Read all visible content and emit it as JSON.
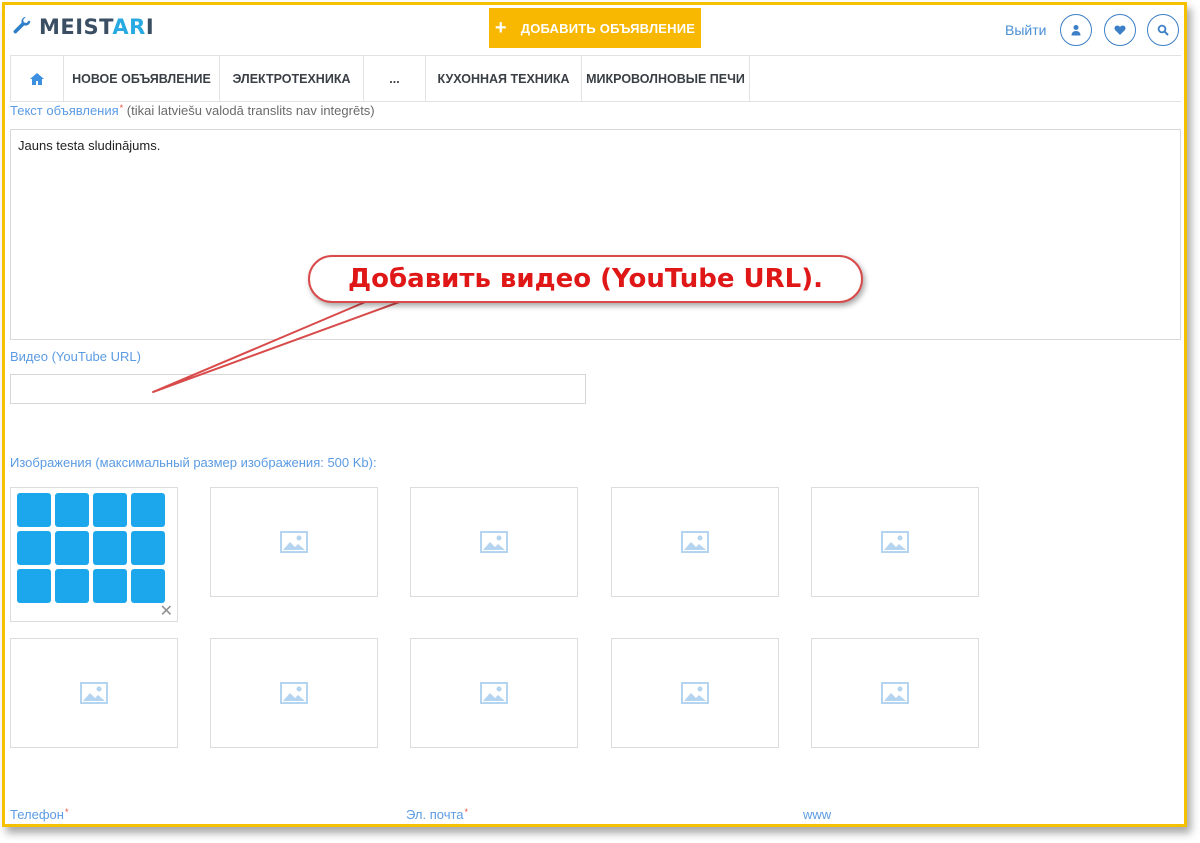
{
  "header": {
    "logo_main": "MEIST",
    "logo_accent": "AR",
    "logo_end": "I",
    "add_button": "ДОБАВИТЬ ОБЪЯВЛЕНИЕ",
    "logout": "Выйти",
    "icons": [
      "user-icon",
      "heart-icon",
      "search-icon"
    ],
    "accent_color": "#f8b700",
    "link_color": "#4a8fd6"
  },
  "nav": {
    "items": [
      "НОВОЕ ОБЪЯВЛЕНИЕ",
      "ЭЛЕКТРОТЕХНИКА",
      "...",
      "КУХОННАЯ ТЕХНИКА",
      "МИКРОВОЛНОВЫЕ ПЕЧИ"
    ]
  },
  "form": {
    "text_label": "Текст объявления",
    "text_hint": "(tikai latviešu valodā translits nav integrēts)",
    "text_value": "Jauns testa sludinājums.",
    "video_label": "Видео (YouTube URL)",
    "video_value": "",
    "images_label": "Изображения (максимальный размер изображения: 500 Kb):",
    "phone_label": "Телефон",
    "email_label": "Эл. почта",
    "www_label": "www"
  },
  "callout": {
    "text": "Добавить видео (YouTube URL).",
    "color": "#e01717"
  }
}
